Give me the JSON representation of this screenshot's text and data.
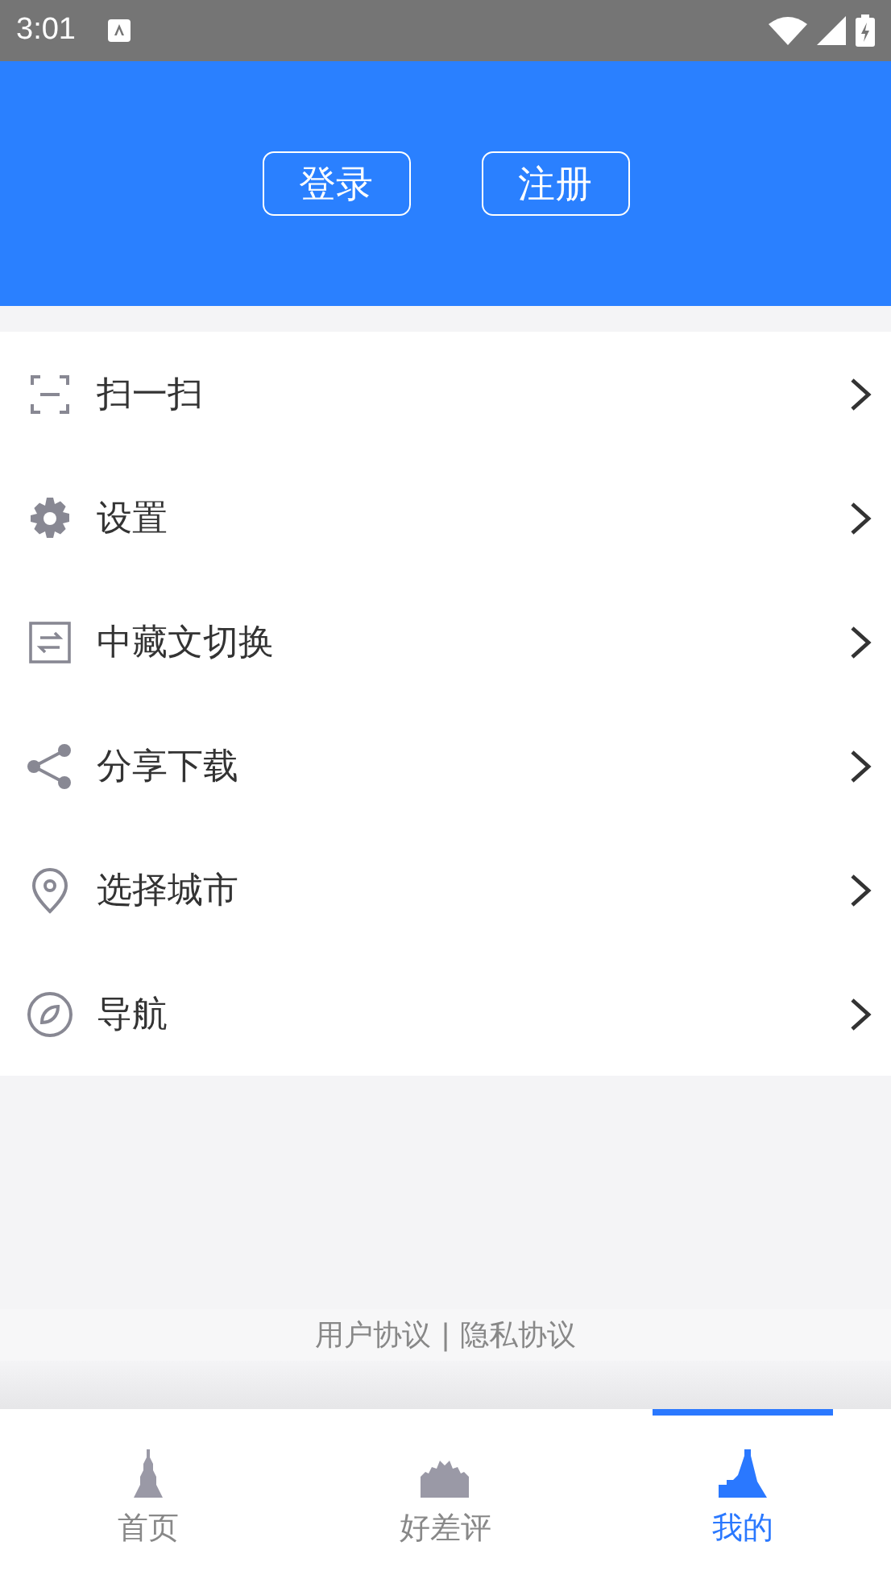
{
  "status_bar": {
    "time": "3:01"
  },
  "header": {
    "buttons": [
      "登录",
      "注册"
    ]
  },
  "menu": [
    {
      "kind": "scan",
      "label": "扫一扫"
    },
    {
      "kind": "settings",
      "label": "设置"
    },
    {
      "kind": "language",
      "label": "中藏文切换"
    },
    {
      "kind": "share",
      "label": "分享下载"
    },
    {
      "kind": "location",
      "label": "选择城市"
    },
    {
      "kind": "compass",
      "label": "导航"
    }
  ],
  "footer": {
    "links": [
      "用户协议",
      "隐私协议"
    ],
    "separator": "|"
  },
  "bottom_nav": [
    {
      "kind": "stupa",
      "label": "首页",
      "selected": false
    },
    {
      "kind": "palace",
      "label": "好差评",
      "selected": false
    },
    {
      "kind": "mountain",
      "label": "我的",
      "selected": true
    }
  ]
}
